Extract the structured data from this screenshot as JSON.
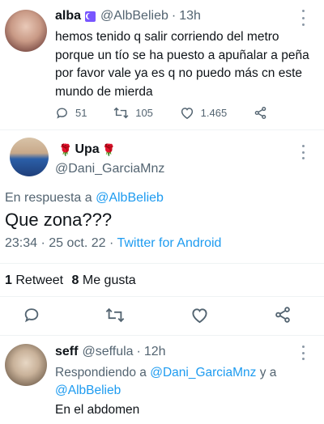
{
  "tweet1": {
    "name": "alba",
    "handle": "@AlbBelieb",
    "separator": "·",
    "time": "13h",
    "text": "hemos tenido q salir corriendo del metro porque un tío se ha puesto a apuñalar a peña por favor vale ya es q no puedo más cn este mundo de mierda",
    "replies": "51",
    "retweets": "105",
    "likes": "1.465"
  },
  "tweet2": {
    "name_prefix": "🌹",
    "name": "Upa",
    "name_suffix": "🌹",
    "handle": "@Dani_GarciaMnz",
    "reply_to_prefix": "En respuesta a",
    "reply_to_handle": "@AlbBelieb",
    "text": "Que zona???",
    "time": "23:34 · 25 oct. 22",
    "separator": "·",
    "source": "Twitter for Android",
    "retweet_count": "1",
    "retweet_label": "Retweet",
    "like_count": "8",
    "like_label": "Me gusta"
  },
  "tweet3": {
    "name": "seff",
    "handle": "@seffula",
    "separator": "·",
    "time": "12h",
    "replying_prefix": "Respondiendo a",
    "replying_handle1": "@Dani_GarciaMnz",
    "replying_and": "y a",
    "replying_handle2": "@AlbBelieb",
    "text": "En el abdomen"
  },
  "colors": {
    "accent": "#1d9bf0",
    "secondary_text": "#536471",
    "divider": "#eff3f4",
    "badge": "#7856ff"
  }
}
